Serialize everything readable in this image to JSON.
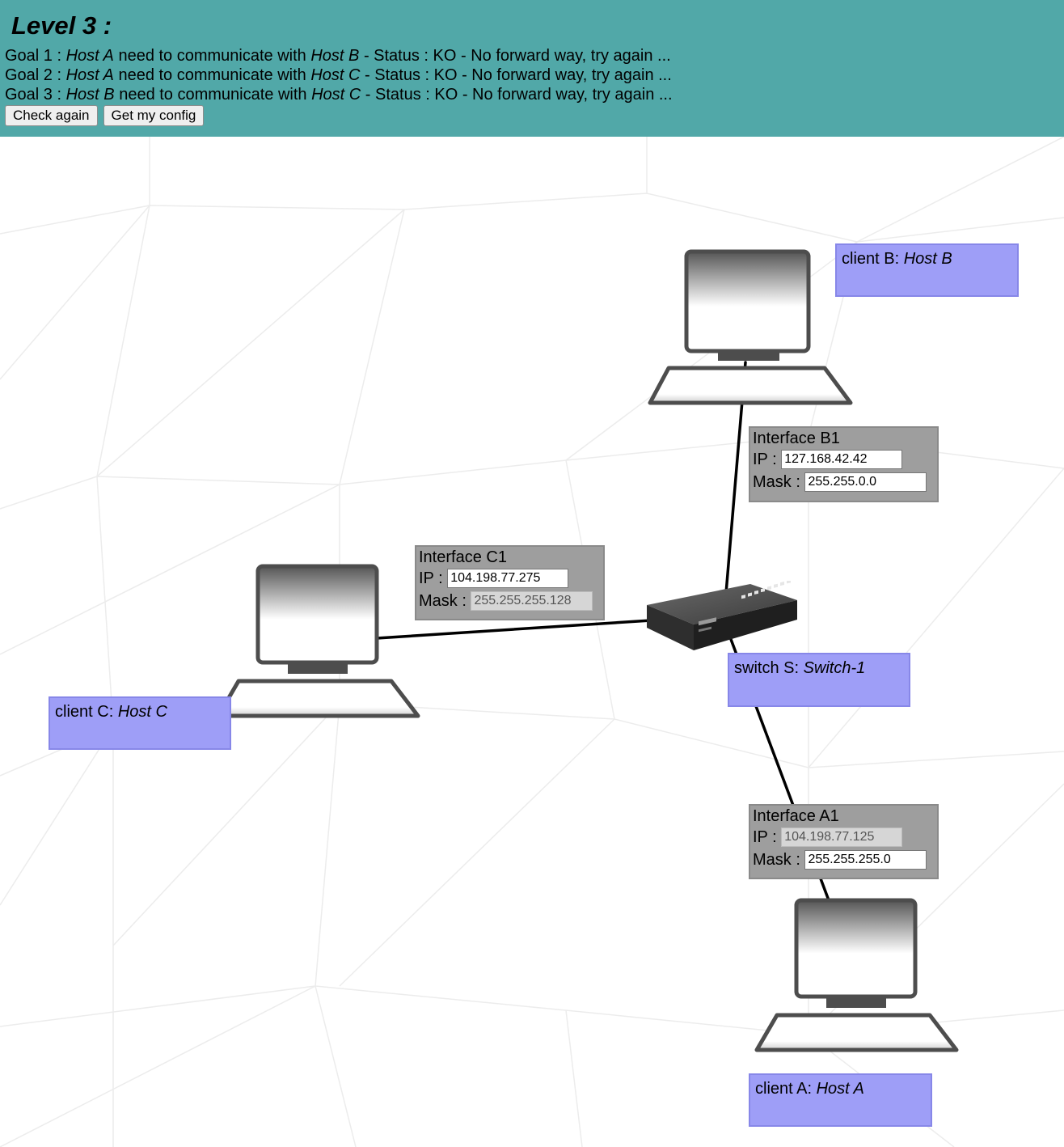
{
  "level": {
    "title": "Level 3 :"
  },
  "goals": [
    {
      "prefix": "Goal 1 : ",
      "from": "Host A",
      "middle": " need to communicate with ",
      "to": "Host B",
      "status": " - Status : KO - No forward way, try again ..."
    },
    {
      "prefix": "Goal 2 : ",
      "from": "Host A",
      "middle": " need to communicate with ",
      "to": "Host C",
      "status": " - Status : KO - No forward way, try again ..."
    },
    {
      "prefix": "Goal 3 : ",
      "from": "Host B",
      "middle": " need to communicate with ",
      "to": "Host C",
      "status": " - Status : KO - No forward way, try again ..."
    }
  ],
  "buttons": {
    "check": "Check again",
    "config": "Get my config"
  },
  "clients": {
    "b": {
      "kind": "client B: ",
      "name": "Host B"
    },
    "c": {
      "kind": "client C: ",
      "name": "Host C"
    },
    "a": {
      "kind": "client A: ",
      "name": "Host A"
    }
  },
  "switch": {
    "kind": "switch S: ",
    "name": "Switch-1"
  },
  "interfaces": {
    "b1": {
      "title": "Interface B1",
      "ip_label": "IP : ",
      "ip": "127.168.42.42",
      "mask_label": "Mask : ",
      "mask": "255.255.0.0"
    },
    "c1": {
      "title": "Interface C1",
      "ip_label": "IP : ",
      "ip": "104.198.77.275",
      "mask_label": "Mask : ",
      "mask": "255.255.255.128"
    },
    "a1": {
      "title": "Interface A1",
      "ip_label": "IP : ",
      "ip": "104.198.77.125",
      "mask_label": "Mask : ",
      "mask": "255.255.255.0"
    }
  },
  "icons": {
    "computer": "computer-icon",
    "switch": "network-switch-icon"
  },
  "colors": {
    "header": "#51a8a8",
    "label_box": "#9e9ef7",
    "interface_box": "#9e9e9e"
  }
}
